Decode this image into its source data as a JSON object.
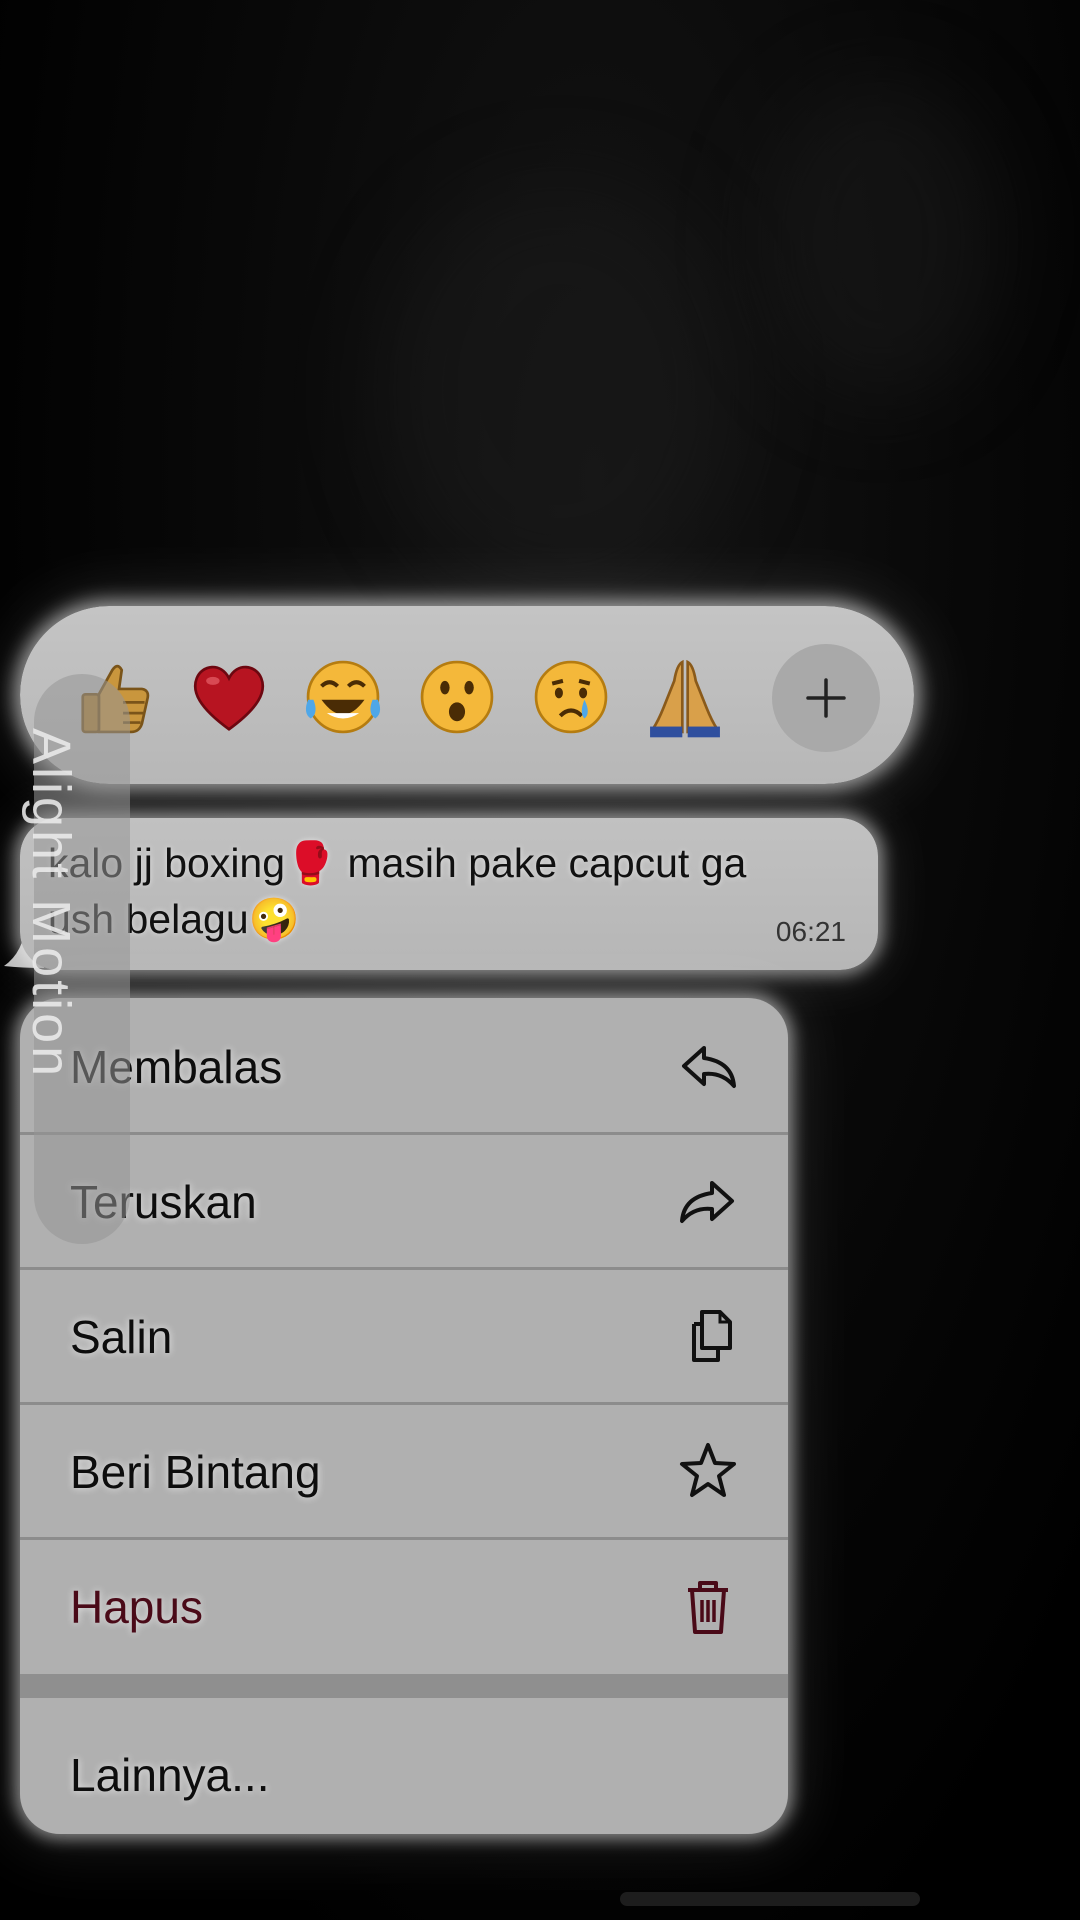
{
  "reactions": {
    "emojis": [
      {
        "char": "👍",
        "name": "thumbs-up"
      },
      {
        "char": "❤️",
        "name": "red-heart"
      },
      {
        "char": "😂",
        "name": "tears-of-joy"
      },
      {
        "char": "😮",
        "name": "open-mouth"
      },
      {
        "char": "😢",
        "name": "crying-face"
      },
      {
        "char": "🙏",
        "name": "folded-hands"
      }
    ],
    "more_icon": "plus-icon"
  },
  "message": {
    "line1": "kalo jj boxing🥊 masih pake capcut ga",
    "line2": "ush belagu🤪",
    "time": "06:21"
  },
  "menu": {
    "items": [
      {
        "label": "Membalas",
        "icon": "reply-icon"
      },
      {
        "label": "Teruskan",
        "icon": "forward-icon"
      },
      {
        "label": "Salin",
        "icon": "copy-icon"
      },
      {
        "label": "Beri Bintang",
        "icon": "star-icon"
      },
      {
        "label": "Hapus",
        "icon": "trash-icon"
      }
    ],
    "more_label": "Lainnya..."
  },
  "watermark": {
    "text": "Alight Motion"
  },
  "colors": {
    "danger": "#4a0a18",
    "surface": "#b0b0b0"
  }
}
